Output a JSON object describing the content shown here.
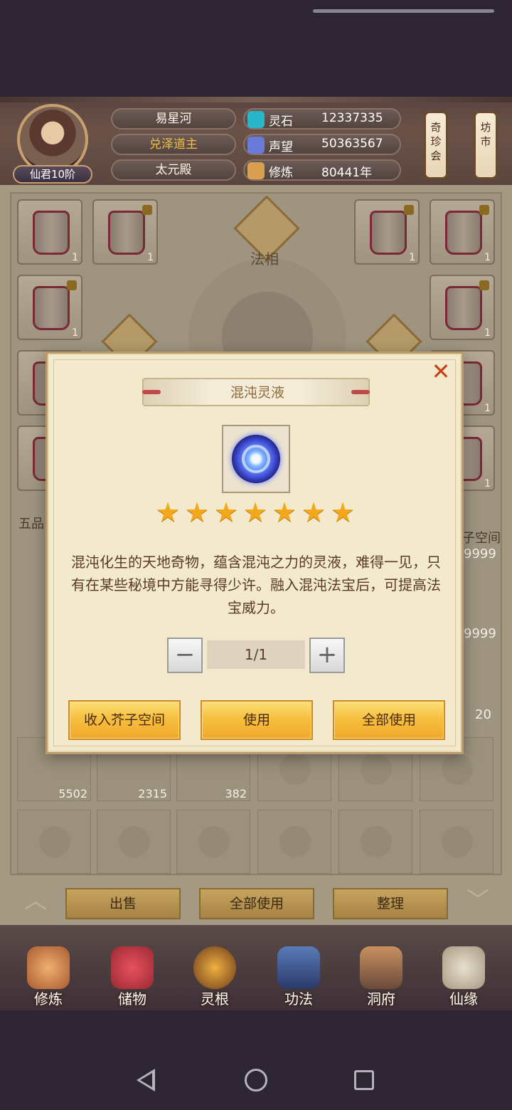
{
  "header": {
    "name": "易星河",
    "title": "兑泽道主",
    "sect": "太元殿",
    "rank": "仙君10阶",
    "resources": [
      {
        "label": "灵石",
        "value": "12337335",
        "color": "#2bb5c8"
      },
      {
        "label": "声望",
        "value": "50363567",
        "color": "#6a7ad8"
      },
      {
        "label": "修炼",
        "value": "80441年",
        "color": "#d8a050"
      }
    ],
    "side_buttons": [
      "奇珍会",
      "坊市"
    ]
  },
  "background": {
    "faxiang_label": "法相",
    "wupin_label": "五品",
    "jiezi_label": "子空间",
    "equip_counts": [
      "1",
      "1",
      "1",
      "1",
      "1",
      "1",
      "1",
      "1",
      "1"
    ],
    "side_counts": [
      "9999",
      "9999",
      "20"
    ],
    "bag_counts": [
      "5502",
      "2315",
      "382"
    ],
    "bottom_buttons": [
      "出售",
      "全部使用",
      "整理"
    ]
  },
  "nav": {
    "items": [
      "修炼",
      "储物",
      "灵根",
      "功法",
      "洞府",
      "仙缘"
    ]
  },
  "modal": {
    "title": "混沌灵液",
    "star_count": 7,
    "description": "混沌化生的天地奇物，蕴含混沌之力的灵液，难得一见，只有在某些秘境中方能寻得少许。融入混沌法宝后，可提高法宝威力。",
    "quantity": "1/1",
    "minus": "−",
    "plus": "+",
    "close": "✕",
    "buttons": [
      "收入芥子空间",
      "使用",
      "全部使用"
    ]
  }
}
